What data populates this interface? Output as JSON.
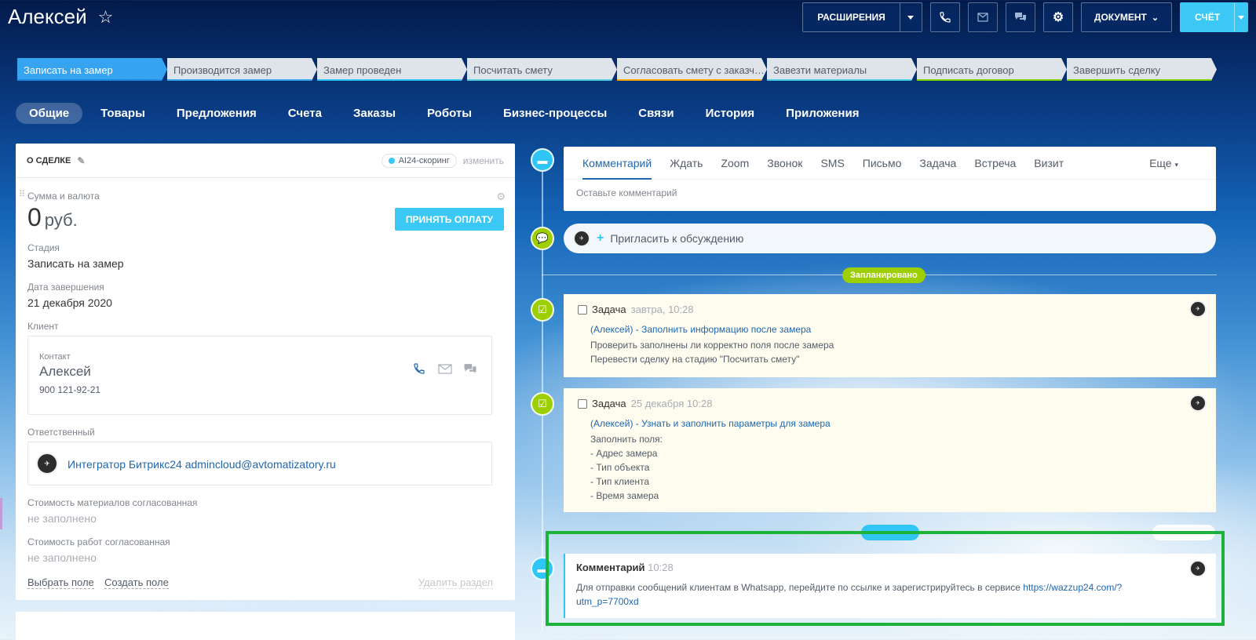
{
  "header": {
    "title": "Алексей",
    "star_icon": "star-icon",
    "buttons": {
      "extensions": "РАСШИРЕНИЯ",
      "document": "ДОКУМЕНТ",
      "invoice": "СЧЁТ"
    }
  },
  "stages": [
    {
      "label": "Записать на замер",
      "color": "#36a4f0",
      "active": true
    },
    {
      "label": "Производится замер",
      "color": "#39a8ef"
    },
    {
      "label": "Замер проведен",
      "color": "#2fc6f6"
    },
    {
      "label": "Посчитать смету",
      "color": "#55d0e0"
    },
    {
      "label": "Согласовать смету с заказч…",
      "color": "#f7a700"
    },
    {
      "label": "Завезти материалы",
      "color": "#47d1e2"
    },
    {
      "label": "Подписать договор",
      "color": "#7bd500"
    },
    {
      "label": "Завершить сделку",
      "color": "#7bd500"
    }
  ],
  "tabs": [
    "Общие",
    "Товары",
    "Предложения",
    "Счета",
    "Заказы",
    "Роботы",
    "Бизнес-процессы",
    "Связи",
    "История",
    "Приложения"
  ],
  "deal": {
    "title": "О СДЕЛКЕ",
    "scoring": "AI24-скоринг",
    "change": "изменить",
    "sum_label": "Сумма и валюта",
    "sum_value": "0",
    "currency": "руб.",
    "pay_button": "ПРИНЯТЬ ОПЛАТУ",
    "stage_label": "Стадия",
    "stage_value": "Записать на замер",
    "date_label": "Дата завершения",
    "date_value": "21 декабря 2020",
    "client_label": "Клиент",
    "contact_label": "Контакт",
    "contact_name": "Алексей",
    "contact_phone": "900 121-92-21",
    "responsible_label": "Ответственный",
    "responsible_name": "Интегратор Битрикс24 admincloud@avtomatizatory.ru",
    "materials_label": "Стоимость материалов согласованная",
    "materials_value": "не заполнено",
    "works_label": "Стоимость работ согласованная",
    "works_value": "не заполнено",
    "select_field": "Выбрать поле",
    "create_field": "Создать поле",
    "delete_section": "Удалить раздел"
  },
  "editor": {
    "tabs": [
      "Комментарий",
      "Ждать",
      "Zoom",
      "Звонок",
      "SMS",
      "Письмо",
      "Задача",
      "Встреча",
      "Визит"
    ],
    "more": "Еще",
    "placeholder": "Оставьте комментарий"
  },
  "invite": "Пригласить к обсуждению",
  "planned_badge": "Запланировано",
  "tasks": [
    {
      "type": "Задача",
      "time": "завтра, 10:28",
      "link": "(Алексей) - Заполнить информацию после замера",
      "lines": [
        "Проверить заполнены ли корректно поля после замера",
        "Перевести сделку на стадию \"Посчитать смету\""
      ]
    },
    {
      "type": "Задача",
      "time": "25 декабря 10:28",
      "link": "(Алексей) - Узнать и заполнить параметры для замера",
      "lines": [
        "Заполнить поля:",
        "- Адрес замера",
        "- Тип объекта",
        "- Тип клиента",
        "- Время замера"
      ]
    }
  ],
  "comment": {
    "type": "Комментарий",
    "time": "10:28",
    "text": "Для отправки сообщений клиентам в Whatsapp, перейдите по ссылке и зарегистрируйтесь в сервисе ",
    "link": "https://wazzup24.com/?utm_p=7700xd"
  }
}
